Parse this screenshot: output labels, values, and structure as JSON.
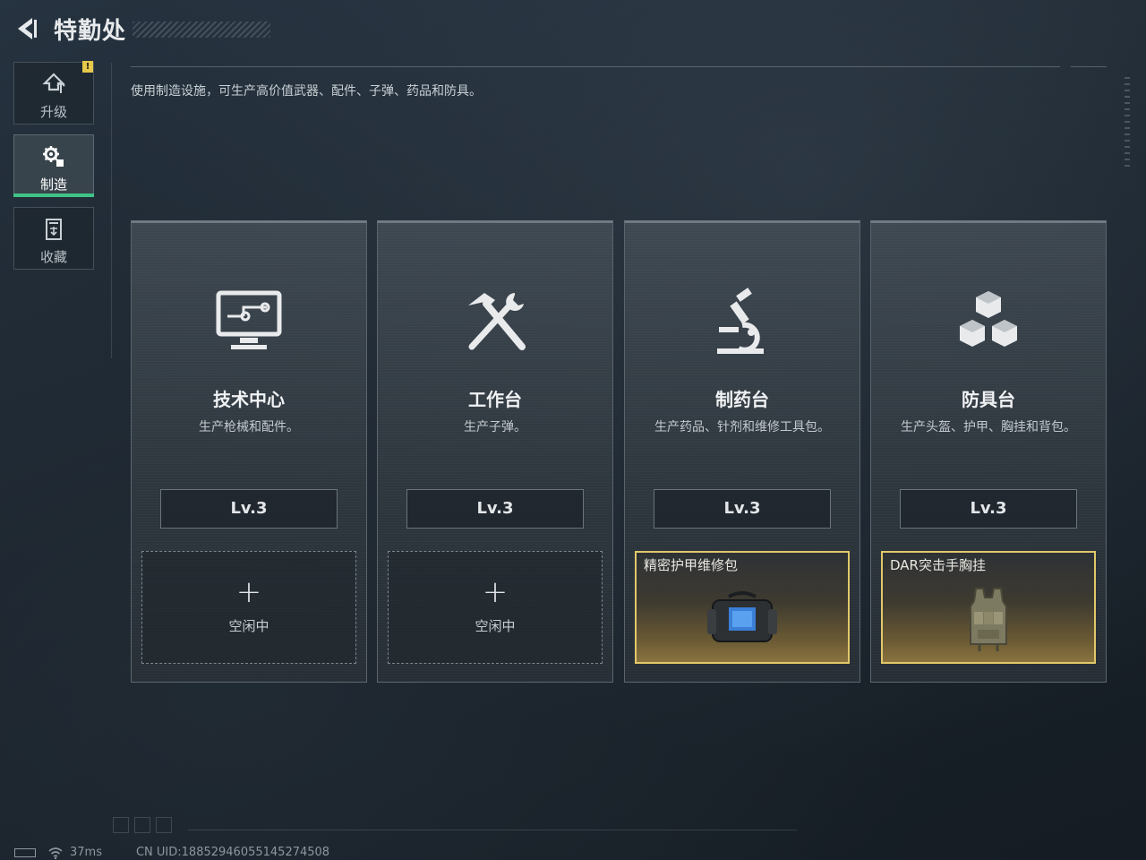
{
  "header": {
    "title": "特勤处",
    "back_icon": "back-arrow-icon"
  },
  "sidebar": {
    "tabs": [
      {
        "label": "升级",
        "icon": "upgrade-icon",
        "active": false,
        "alert": true
      },
      {
        "label": "制造",
        "icon": "gears-icon",
        "active": true
      },
      {
        "label": "收藏",
        "icon": "collection-icon",
        "active": false
      }
    ],
    "alert_badge": "!"
  },
  "description": "使用制造设施，可生产高价值武器、配件、子弹、药品和防具。",
  "facilities": [
    {
      "name": "技术中心",
      "desc": "生产枪械和配件。",
      "level": "Lv.3",
      "icon": "tech-monitor-icon",
      "slot": {
        "state": "空闲中",
        "item": null
      }
    },
    {
      "name": "工作台",
      "desc": "生产子弹。",
      "level": "Lv.3",
      "icon": "hammer-wrench-icon",
      "slot": {
        "state": "空闲中",
        "item": null
      }
    },
    {
      "name": "制药台",
      "desc": "生产药品、针剂和维修工具包。",
      "level": "Lv.3",
      "icon": "microscope-icon",
      "slot": {
        "state": "",
        "item": "精密护甲维修包"
      }
    },
    {
      "name": "防具台",
      "desc": "生产头盔、护甲、胸挂和背包。",
      "level": "Lv.3",
      "icon": "cubes-icon",
      "slot": {
        "state": "",
        "item": "DAR突击手胸挂"
      }
    }
  ],
  "slot_add_symbol": "+",
  "status": {
    "ping": "37ms",
    "uid": "CN UID:18852946055145274508"
  },
  "colors": {
    "accent_green": "#3fc486",
    "item_gold_border": "#e2c86a",
    "alert_yellow": "#e6c84a"
  }
}
